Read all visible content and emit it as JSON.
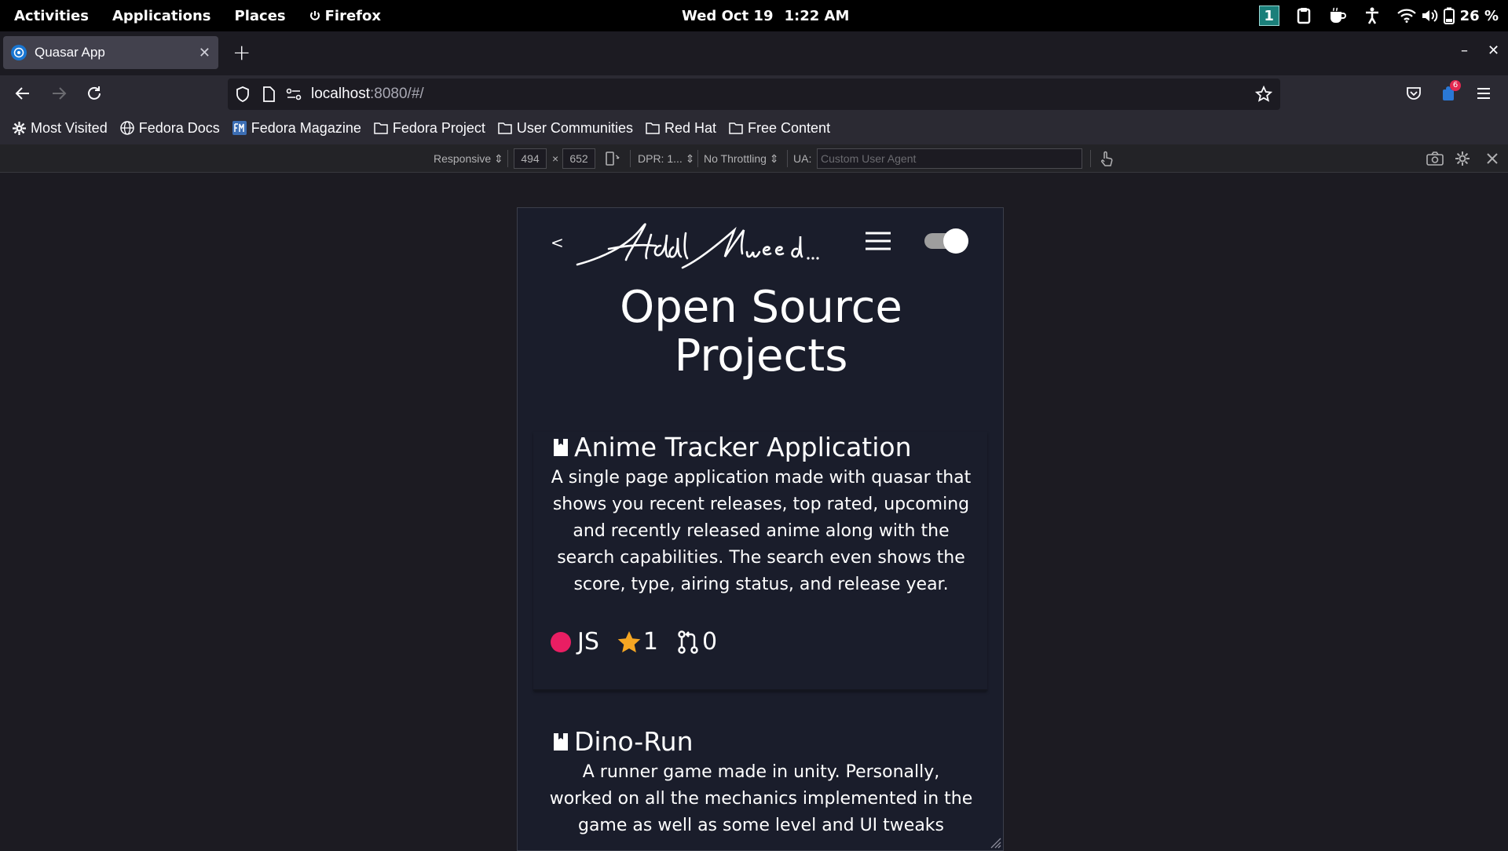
{
  "system": {
    "activities": "Activities",
    "applications": "Applications",
    "places": "Places",
    "app_name": "Firefox",
    "date": "Wed Oct 19",
    "time": "1:22 AM",
    "workspace": "1",
    "battery": "26 %"
  },
  "browser": {
    "tab_title": "Quasar App",
    "url_host": "localhost",
    "url_path": ":8080/#/",
    "extension_badge": "6",
    "bookmarks": [
      {
        "label": "Most Visited",
        "icon": "gear-icon"
      },
      {
        "label": "Fedora Docs",
        "icon": "globe-icon"
      },
      {
        "label": "Fedora Magazine",
        "icon": "fm-icon"
      },
      {
        "label": "Fedora Project",
        "icon": "folder-icon"
      },
      {
        "label": "User Communities",
        "icon": "folder-icon"
      },
      {
        "label": "Red Hat",
        "icon": "folder-icon"
      },
      {
        "label": "Free Content",
        "icon": "folder-icon"
      }
    ]
  },
  "devtools": {
    "device": "Responsive",
    "width": "494",
    "times": "×",
    "height": "652",
    "dpr": "DPR: 1...",
    "throttling": "No Throttling",
    "ua_label": "UA:",
    "ua_placeholder": "Custom User Agent"
  },
  "page": {
    "back": "<",
    "signature": "Abdul Mueed...",
    "title_line1": "Open Source",
    "title_line2": "Projects",
    "projects": [
      {
        "title": "Anime Tracker Application",
        "description": "A single page application made with quasar that shows you recent releases, top rated, upcoming and recently released anime along with the search capabilities. The search even shows the score, type, airing status, and release year.",
        "language": "JS",
        "language_color": "#e91e63",
        "stars": "1",
        "pulls": "0"
      },
      {
        "title": "Dino-Run",
        "description": "A runner game made in unity. Personally, worked on all the mechanics implemented in the game as well as some level and UI tweaks"
      }
    ]
  },
  "colors": {
    "page_bg": "#1a1d2b",
    "star": "#f5a623"
  }
}
